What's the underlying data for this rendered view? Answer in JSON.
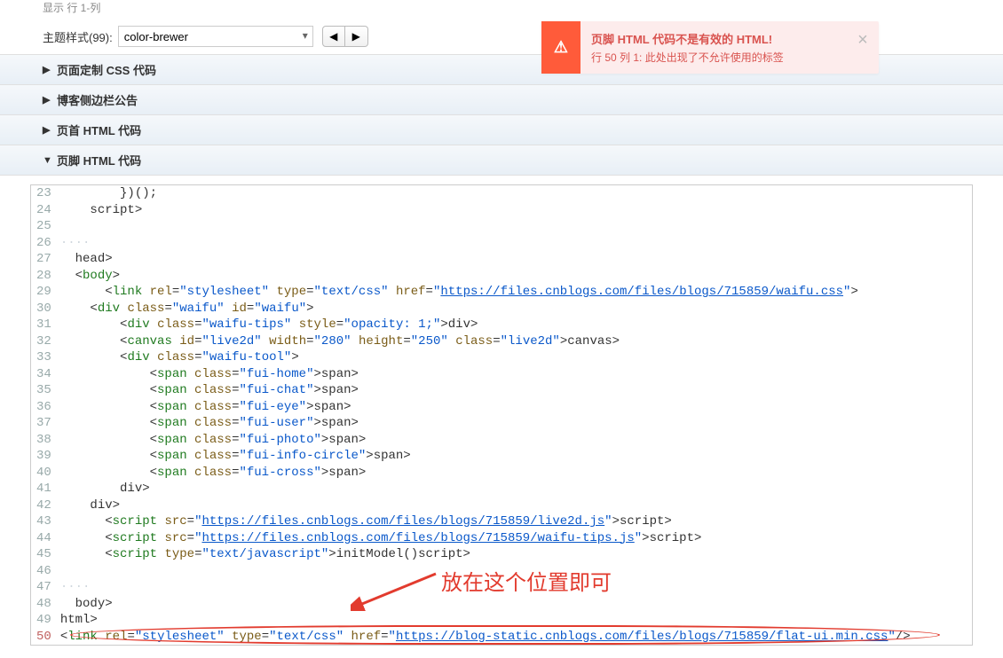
{
  "truncated_row_label": "显示 行 1-列",
  "topbar": {
    "label": "主题样式(99):",
    "select_value": "color-brewer",
    "prev": "◀",
    "next": "▶"
  },
  "alert": {
    "icon": "⚠",
    "title": "页脚 HTML 代码不是有效的 HTML!",
    "message": "行 50 列 1: 此处出现了不允许使用的标签",
    "close": "×"
  },
  "accordion": [
    {
      "label": "页面定制 CSS 代码",
      "open": false
    },
    {
      "label": "博客侧边栏公告",
      "open": false
    },
    {
      "label": "页首 HTML 代码",
      "open": false
    },
    {
      "label": "页脚 HTML 代码",
      "open": true
    }
  ],
  "annotation": "放在这个位置即可",
  "code_lines": [
    {
      "n": 23,
      "html": "        })();"
    },
    {
      "n": 24,
      "html": "    </<span class='tok-tag'>script</span>>"
    },
    {
      "n": 25,
      "html": ""
    },
    {
      "n": 26,
      "html": "<span class='tok-dot'>····</span>"
    },
    {
      "n": 27,
      "html": "  </<span class='tok-tag'>head</span>>"
    },
    {
      "n": 28,
      "html": "  <<span class='tok-tag'>body</span>>"
    },
    {
      "n": 29,
      "html": "      <<span class='tok-tag'>link</span> <span class='tok-attr'>rel</span>=<span class='tok-str'>\"stylesheet\"</span> <span class='tok-attr'>type</span>=<span class='tok-str'>\"text/css\"</span> <span class='tok-attr'>href</span>=<span class='tok-str'>\"</span><span class='tok-url'>https://files.cnblogs.com/files/blogs/715859/waifu.css</span><span class='tok-str'>\"</span>>"
    },
    {
      "n": 30,
      "html": "    <<span class='tok-tag'>div</span> <span class='tok-attr'>class</span>=<span class='tok-str'>\"waifu\"</span> <span class='tok-attr'>id</span>=<span class='tok-str'>\"waifu\"</span>>"
    },
    {
      "n": 31,
      "html": "        <<span class='tok-tag'>div</span> <span class='tok-attr'>class</span>=<span class='tok-str'>\"waifu-tips\"</span> <span class='tok-attr'>style</span>=<span class='tok-str'>\"opacity: 1;\"</span>></<span class='tok-tag'>div</span>>"
    },
    {
      "n": 32,
      "html": "        <<span class='tok-tag'>canvas</span> <span class='tok-attr'>id</span>=<span class='tok-str'>\"live2d\"</span> <span class='tok-attr'>width</span>=<span class='tok-str'>\"280\"</span> <span class='tok-attr'>height</span>=<span class='tok-str'>\"250\"</span> <span class='tok-attr'>class</span>=<span class='tok-str'>\"live2d\"</span>></<span class='tok-tag'>canvas</span>>"
    },
    {
      "n": 33,
      "html": "        <<span class='tok-tag'>div</span> <span class='tok-attr'>class</span>=<span class='tok-str'>\"waifu-tool\"</span>>"
    },
    {
      "n": 34,
      "html": "            <<span class='tok-tag'>span</span> <span class='tok-attr'>class</span>=<span class='tok-str'>\"fui-home\"</span>></<span class='tok-tag'>span</span>>"
    },
    {
      "n": 35,
      "html": "            <<span class='tok-tag'>span</span> <span class='tok-attr'>class</span>=<span class='tok-str'>\"fui-chat\"</span>></<span class='tok-tag'>span</span>>"
    },
    {
      "n": 36,
      "html": "            <<span class='tok-tag'>span</span> <span class='tok-attr'>class</span>=<span class='tok-str'>\"fui-eye\"</span>></<span class='tok-tag'>span</span>>"
    },
    {
      "n": 37,
      "html": "            <<span class='tok-tag'>span</span> <span class='tok-attr'>class</span>=<span class='tok-str'>\"fui-user\"</span>></<span class='tok-tag'>span</span>>"
    },
    {
      "n": 38,
      "html": "            <<span class='tok-tag'>span</span> <span class='tok-attr'>class</span>=<span class='tok-str'>\"fui-photo\"</span>></<span class='tok-tag'>span</span>>"
    },
    {
      "n": 39,
      "html": "            <<span class='tok-tag'>span</span> <span class='tok-attr'>class</span>=<span class='tok-str'>\"fui-info-circle\"</span>></<span class='tok-tag'>span</span>>"
    },
    {
      "n": 40,
      "html": "            <<span class='tok-tag'>span</span> <span class='tok-attr'>class</span>=<span class='tok-str'>\"fui-cross\"</span>></<span class='tok-tag'>span</span>>"
    },
    {
      "n": 41,
      "html": "        </<span class='tok-tag'>div</span>>"
    },
    {
      "n": 42,
      "html": "    </<span class='tok-tag'>div</span>>"
    },
    {
      "n": 43,
      "html": "      <<span class='tok-tag'>script</span> <span class='tok-attr'>src</span>=<span class='tok-str'>\"</span><span class='tok-url'>https://files.cnblogs.com/files/blogs/715859/live2d.js</span><span class='tok-str'>\"</span>></<span class='tok-tag'>script</span>>"
    },
    {
      "n": 44,
      "html": "      <<span class='tok-tag'>script</span> <span class='tok-attr'>src</span>=<span class='tok-str'>\"</span><span class='tok-url'>https://files.cnblogs.com/files/blogs/715859/waifu-tips.js</span><span class='tok-str'>\"</span>></<span class='tok-tag'>script</span>>"
    },
    {
      "n": 45,
      "html": "      <<span class='tok-tag'>script</span> <span class='tok-attr'>type</span>=<span class='tok-str'>\"text/javascript\"</span>><span class='tok-fn'>initModel()</span></<span class='tok-tag'>script</span>>"
    },
    {
      "n": 46,
      "html": ""
    },
    {
      "n": 47,
      "html": "<span class='tok-dot'>····</span>"
    },
    {
      "n": 48,
      "html": "  </<span class='tok-tag'>body</span>>"
    },
    {
      "n": 49,
      "html": "</<span class='tok-tag'>html</span>>"
    },
    {
      "n": 50,
      "hl": true,
      "html": "<<span class='tok-tag'>link</span> <span class='tok-attr'>rel</span>=<span class='tok-str'>\"stylesheet\"</span> <span class='tok-attr'>type</span>=<span class='tok-str'>\"text/css\"</span> <span class='tok-attr'>href</span>=<span class='tok-str'>\"</span><span class='tok-url'>https://blog-static.cnblogs.com/files/blogs/715859/flat-ui.min.css</span><span class='tok-str'>\"</span>/>"
    }
  ]
}
